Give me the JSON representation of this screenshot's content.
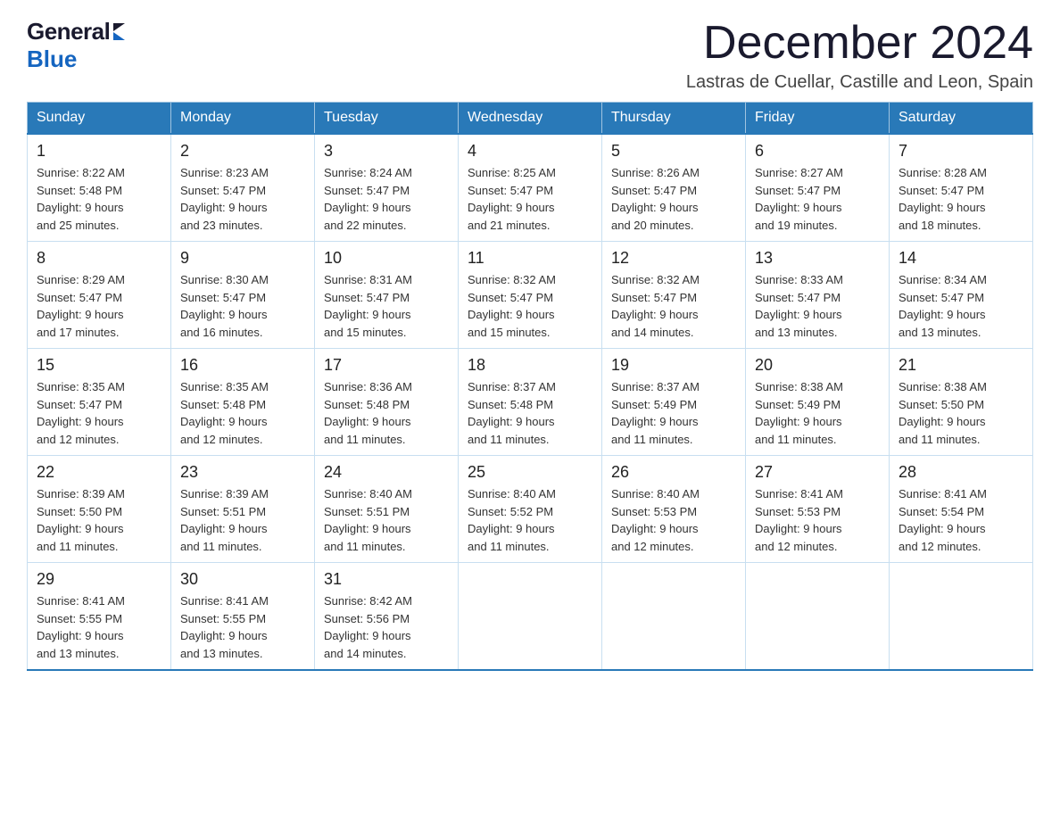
{
  "logo": {
    "general": "General",
    "blue": "Blue"
  },
  "title": {
    "month_year": "December 2024",
    "location": "Lastras de Cuellar, Castille and Leon, Spain"
  },
  "weekdays": [
    "Sunday",
    "Monday",
    "Tuesday",
    "Wednesday",
    "Thursday",
    "Friday",
    "Saturday"
  ],
  "weeks": [
    [
      {
        "day": "1",
        "sunrise": "8:22 AM",
        "sunset": "5:48 PM",
        "daylight": "9 hours and 25 minutes."
      },
      {
        "day": "2",
        "sunrise": "8:23 AM",
        "sunset": "5:47 PM",
        "daylight": "9 hours and 23 minutes."
      },
      {
        "day": "3",
        "sunrise": "8:24 AM",
        "sunset": "5:47 PM",
        "daylight": "9 hours and 22 minutes."
      },
      {
        "day": "4",
        "sunrise": "8:25 AM",
        "sunset": "5:47 PM",
        "daylight": "9 hours and 21 minutes."
      },
      {
        "day": "5",
        "sunrise": "8:26 AM",
        "sunset": "5:47 PM",
        "daylight": "9 hours and 20 minutes."
      },
      {
        "day": "6",
        "sunrise": "8:27 AM",
        "sunset": "5:47 PM",
        "daylight": "9 hours and 19 minutes."
      },
      {
        "day": "7",
        "sunrise": "8:28 AM",
        "sunset": "5:47 PM",
        "daylight": "9 hours and 18 minutes."
      }
    ],
    [
      {
        "day": "8",
        "sunrise": "8:29 AM",
        "sunset": "5:47 PM",
        "daylight": "9 hours and 17 minutes."
      },
      {
        "day": "9",
        "sunrise": "8:30 AM",
        "sunset": "5:47 PM",
        "daylight": "9 hours and 16 minutes."
      },
      {
        "day": "10",
        "sunrise": "8:31 AM",
        "sunset": "5:47 PM",
        "daylight": "9 hours and 15 minutes."
      },
      {
        "day": "11",
        "sunrise": "8:32 AM",
        "sunset": "5:47 PM",
        "daylight": "9 hours and 15 minutes."
      },
      {
        "day": "12",
        "sunrise": "8:32 AM",
        "sunset": "5:47 PM",
        "daylight": "9 hours and 14 minutes."
      },
      {
        "day": "13",
        "sunrise": "8:33 AM",
        "sunset": "5:47 PM",
        "daylight": "9 hours and 13 minutes."
      },
      {
        "day": "14",
        "sunrise": "8:34 AM",
        "sunset": "5:47 PM",
        "daylight": "9 hours and 13 minutes."
      }
    ],
    [
      {
        "day": "15",
        "sunrise": "8:35 AM",
        "sunset": "5:47 PM",
        "daylight": "9 hours and 12 minutes."
      },
      {
        "day": "16",
        "sunrise": "8:35 AM",
        "sunset": "5:48 PM",
        "daylight": "9 hours and 12 minutes."
      },
      {
        "day": "17",
        "sunrise": "8:36 AM",
        "sunset": "5:48 PM",
        "daylight": "9 hours and 11 minutes."
      },
      {
        "day": "18",
        "sunrise": "8:37 AM",
        "sunset": "5:48 PM",
        "daylight": "9 hours and 11 minutes."
      },
      {
        "day": "19",
        "sunrise": "8:37 AM",
        "sunset": "5:49 PM",
        "daylight": "9 hours and 11 minutes."
      },
      {
        "day": "20",
        "sunrise": "8:38 AM",
        "sunset": "5:49 PM",
        "daylight": "9 hours and 11 minutes."
      },
      {
        "day": "21",
        "sunrise": "8:38 AM",
        "sunset": "5:50 PM",
        "daylight": "9 hours and 11 minutes."
      }
    ],
    [
      {
        "day": "22",
        "sunrise": "8:39 AM",
        "sunset": "5:50 PM",
        "daylight": "9 hours and 11 minutes."
      },
      {
        "day": "23",
        "sunrise": "8:39 AM",
        "sunset": "5:51 PM",
        "daylight": "9 hours and 11 minutes."
      },
      {
        "day": "24",
        "sunrise": "8:40 AM",
        "sunset": "5:51 PM",
        "daylight": "9 hours and 11 minutes."
      },
      {
        "day": "25",
        "sunrise": "8:40 AM",
        "sunset": "5:52 PM",
        "daylight": "9 hours and 11 minutes."
      },
      {
        "day": "26",
        "sunrise": "8:40 AM",
        "sunset": "5:53 PM",
        "daylight": "9 hours and 12 minutes."
      },
      {
        "day": "27",
        "sunrise": "8:41 AM",
        "sunset": "5:53 PM",
        "daylight": "9 hours and 12 minutes."
      },
      {
        "day": "28",
        "sunrise": "8:41 AM",
        "sunset": "5:54 PM",
        "daylight": "9 hours and 12 minutes."
      }
    ],
    [
      {
        "day": "29",
        "sunrise": "8:41 AM",
        "sunset": "5:55 PM",
        "daylight": "9 hours and 13 minutes."
      },
      {
        "day": "30",
        "sunrise": "8:41 AM",
        "sunset": "5:55 PM",
        "daylight": "9 hours and 13 minutes."
      },
      {
        "day": "31",
        "sunrise": "8:42 AM",
        "sunset": "5:56 PM",
        "daylight": "9 hours and 14 minutes."
      },
      null,
      null,
      null,
      null
    ]
  ],
  "labels": {
    "sunrise_prefix": "Sunrise: ",
    "sunset_prefix": "Sunset: ",
    "daylight_prefix": "Daylight: "
  }
}
